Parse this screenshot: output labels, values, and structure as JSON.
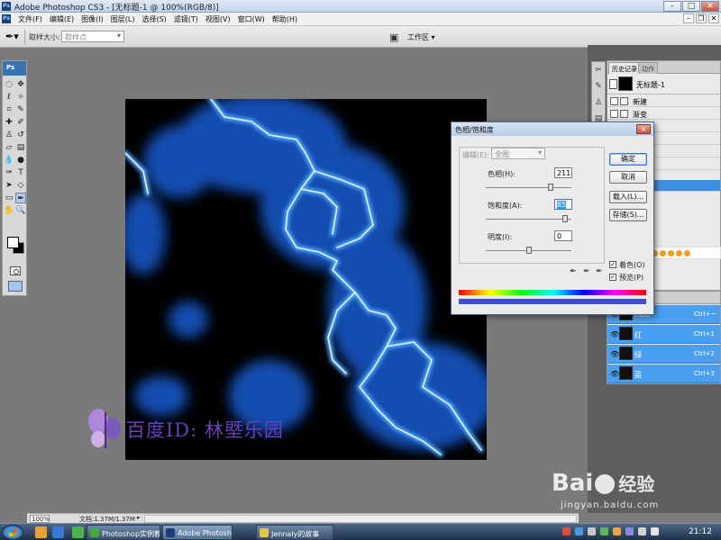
{
  "window": {
    "title": "Adobe Photoshop CS3 - [无标题-1 @ 100%(RGB/8)]",
    "app_icon": "Ps"
  },
  "menubar": {
    "items": [
      "文件(F)",
      "编辑(E)",
      "图像(I)",
      "图层(L)",
      "选择(S)",
      "滤镜(T)",
      "视图(V)",
      "窗口(W)",
      "帮助(H)"
    ]
  },
  "optionsbar": {
    "sample_size_label": "取样大小:",
    "sample_size_value": "取样点",
    "workspace_label": "工作区 ▾"
  },
  "toolbox": {
    "header": "Ps"
  },
  "statusbar": {
    "zoom": "100%",
    "doc_info": "文档:1.37M/1.37M",
    "arrow": "▸"
  },
  "history_panel": {
    "tabs": [
      "历史记录",
      "动作"
    ],
    "close_glyph": "×",
    "snapshot_name": "无标题-1",
    "entries": [
      "新建",
      "渐变"
    ]
  },
  "channels_panel": {
    "rows": [
      {
        "name": "RGB",
        "key": "Ctrl+~"
      },
      {
        "name": "红",
        "key": "Ctrl+1"
      },
      {
        "name": "绿",
        "key": "Ctrl+2"
      },
      {
        "name": "蓝",
        "key": "Ctrl+3"
      }
    ]
  },
  "dialog": {
    "title": "色相/饱和度",
    "close_glyph": "×",
    "edit_label": "编辑(E):",
    "edit_value": "全图",
    "hue_label": "色相(H):",
    "hue_value": "211",
    "saturation_label": "饱和度(A):",
    "saturation_value": "85",
    "lightness_label": "明度(I):",
    "lightness_value": "0",
    "ok_label": "确定",
    "cancel_label": "取消",
    "load_label": "载入(L)...",
    "save_label": "存储(S)...",
    "colorize_label": "着色(O)",
    "preview_label": "预览(P)",
    "colorize_checked": true,
    "preview_checked": true,
    "hue_slider": 0.76,
    "saturation_slider": 0.93,
    "lightness_slider": 0.5
  },
  "canvas_watermark": "百度ID: 林塈乐园",
  "ime_bar": {
    "logo": "S",
    "label": "中"
  },
  "baidu_watermark": {
    "text": "Bai",
    "text2": "经验",
    "url": "jingyan.baidu.com"
  },
  "taskbar": {
    "tasks": [
      "Photoshop实例教程...",
      "Adobe Photoshop ...",
      "Jennaly的故事"
    ],
    "clock": "21:12"
  },
  "colors": {
    "lightning_blue": "#2f8cff",
    "selection_blue": "#4aa0ef",
    "dialog_border": "#5a6b85"
  }
}
